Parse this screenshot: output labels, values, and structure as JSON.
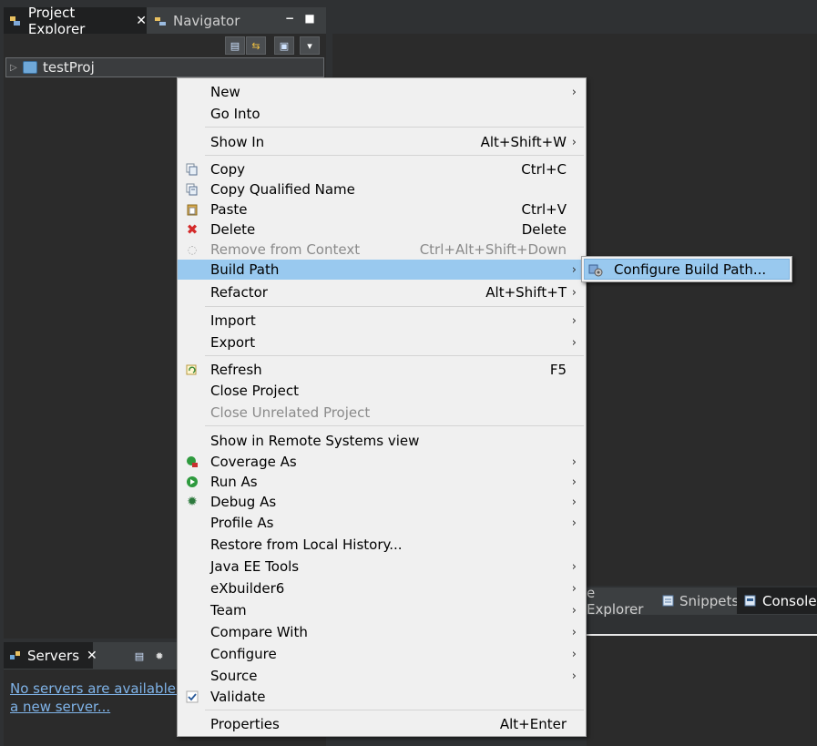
{
  "explorer": {
    "tabs": [
      {
        "label": "Project Explorer",
        "icon": "project-explorer-icon"
      },
      {
        "label": "Navigator",
        "icon": "navigator-icon"
      }
    ],
    "tree": [
      {
        "label": "testProj",
        "icon": "java-project-icon"
      }
    ]
  },
  "context_menu": {
    "items": [
      {
        "label": "New",
        "shortcut": "",
        "submenu": true
      },
      {
        "label": "Go Into",
        "shortcut": ""
      },
      {
        "label": "Show In",
        "shortcut": "Alt+Shift+W",
        "submenu": true
      },
      {
        "label": "Copy",
        "shortcut": "Ctrl+C",
        "icon": "copy-icon"
      },
      {
        "label": "Copy Qualified Name",
        "shortcut": "",
        "icon": "copy-qualified-name-icon"
      },
      {
        "label": "Paste",
        "shortcut": "Ctrl+V",
        "icon": "paste-icon"
      },
      {
        "label": "Delete",
        "shortcut": "Delete",
        "icon": "delete-icon"
      },
      {
        "label": "Remove from Context",
        "shortcut": "Ctrl+Alt+Shift+Down",
        "disabled": true,
        "icon": "remove-context-icon"
      },
      {
        "label": "Build Path",
        "shortcut": "",
        "submenu": true,
        "highlighted": true
      },
      {
        "label": "Refactor",
        "shortcut": "Alt+Shift+T",
        "submenu": true
      },
      {
        "label": "Import",
        "shortcut": "",
        "submenu": true
      },
      {
        "label": "Export",
        "shortcut": "",
        "submenu": true
      },
      {
        "label": "Refresh",
        "shortcut": "F5",
        "icon": "refresh-icon"
      },
      {
        "label": "Close Project",
        "shortcut": ""
      },
      {
        "label": "Close Unrelated Project",
        "shortcut": "",
        "disabled": true
      },
      {
        "label": "Show in Remote Systems view",
        "shortcut": ""
      },
      {
        "label": "Coverage As",
        "shortcut": "",
        "submenu": true,
        "icon": "coverage-icon"
      },
      {
        "label": "Run As",
        "shortcut": "",
        "submenu": true,
        "icon": "run-icon"
      },
      {
        "label": "Debug As",
        "shortcut": "",
        "submenu": true,
        "icon": "debug-icon"
      },
      {
        "label": "Profile As",
        "shortcut": "",
        "submenu": true
      },
      {
        "label": "Restore from Local History...",
        "shortcut": ""
      },
      {
        "label": "Java EE Tools",
        "shortcut": "",
        "submenu": true
      },
      {
        "label": "eXbuilder6",
        "shortcut": "",
        "submenu": true
      },
      {
        "label": "Team",
        "shortcut": "",
        "submenu": true
      },
      {
        "label": "Compare With",
        "shortcut": "",
        "submenu": true
      },
      {
        "label": "Configure",
        "shortcut": "",
        "submenu": true
      },
      {
        "label": "Source",
        "shortcut": "",
        "submenu": true
      },
      {
        "label": "Validate",
        "shortcut": "",
        "icon": "check-icon"
      },
      {
        "label": "Properties",
        "shortcut": "Alt+Enter"
      }
    ]
  },
  "submenu": {
    "label": "Configure Build Path...",
    "icon": "configure-build-path-icon"
  },
  "bottom_tabs": [
    {
      "label": "e Explorer"
    },
    {
      "label": "Snippets",
      "icon": "snippets-icon"
    },
    {
      "label": "Console",
      "icon": "console-icon"
    }
  ],
  "servers": {
    "tab_label": "Servers",
    "link_line1": "No servers are available. Cl",
    "link_line2": "a new server..."
  }
}
